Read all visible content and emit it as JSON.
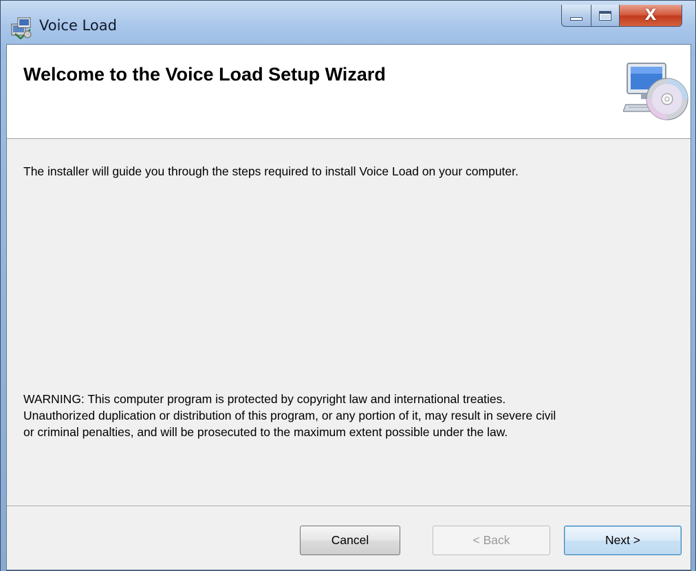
{
  "window": {
    "title": "Voice Load",
    "controls": [
      "minimize-icon",
      "maximize-icon",
      "close-icon"
    ]
  },
  "banner": {
    "title": "Welcome to the Voice Load Setup Wizard",
    "art_icon": "computer-with-disc-icon"
  },
  "body": {
    "intro": "The installer will guide you through the steps required to install Voice Load on your computer.",
    "warning_line1": "WARNING: This computer program is protected by copyright law and international treaties.",
    "warning_line2": "Unauthorized duplication or distribution of this program, or any portion of it, may result in severe civil",
    "warning_line3": "or criminal penalties, and will be prosecuted to the maximum extent possible under the law."
  },
  "buttons": {
    "cancel": "Cancel",
    "back": "< Back",
    "next": "Next >",
    "back_enabled": false
  },
  "colors": {
    "titlebar": "#a9c6ea",
    "client_bg": "#f0f0f0",
    "close_red": "#c13a1c",
    "default_button_border": "#3c7fb1"
  }
}
